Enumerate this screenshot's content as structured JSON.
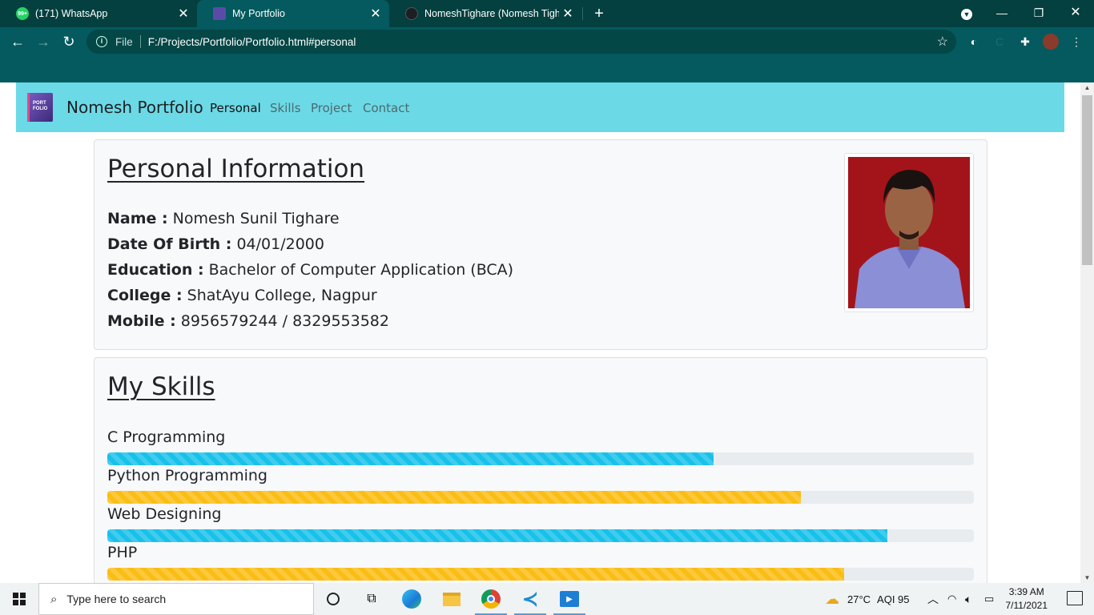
{
  "browser": {
    "tabs": [
      {
        "title": "(171) WhatsApp",
        "badge": "99+"
      },
      {
        "title": "My Portfolio"
      },
      {
        "title": "NomeshTighare (Nomesh Tighare)"
      }
    ],
    "address": {
      "scheme_label": "File",
      "url": "F:/Projects/Portfolio/Portfolio.html#personal"
    }
  },
  "page": {
    "navbar": {
      "logo_text": "PORT FOLIO",
      "brand": "Nomesh Portfolio",
      "links": [
        "Personal",
        "Skills",
        "Project",
        "Contact"
      ],
      "active_link": "Personal"
    },
    "personal": {
      "heading": "Personal Information",
      "rows": [
        {
          "label": "Name :",
          "value": "Nomesh Sunil Tighare"
        },
        {
          "label": "Date Of Birth :",
          "value": "04/01/2000"
        },
        {
          "label": "Education :",
          "value": "Bachelor of Computer Application (BCA)"
        },
        {
          "label": "College :",
          "value": "ShatAyu College, Nagpur"
        },
        {
          "label": "Mobile :",
          "value": "8956579244 / 8329553582"
        }
      ]
    },
    "skills": {
      "heading": "My Skills",
      "items": [
        {
          "name": "C Programming",
          "percent": 70,
          "variant": "info"
        },
        {
          "name": "Python Programming",
          "percent": 80,
          "variant": "warning"
        },
        {
          "name": "Web Designing",
          "percent": 90,
          "variant": "info"
        },
        {
          "name": "PHP",
          "percent": 85,
          "variant": "warning"
        }
      ]
    }
  },
  "taskbar": {
    "search_placeholder": "Type here to search",
    "weather": "27°C",
    "aqi": "AQI 95",
    "time": "3:39 AM",
    "date": "7/11/2021"
  },
  "colors": {
    "navbar": "#6cd9e6",
    "chrome": "#045a5e",
    "progress_info": "#17c1ea",
    "progress_warning": "#fbbd13"
  }
}
